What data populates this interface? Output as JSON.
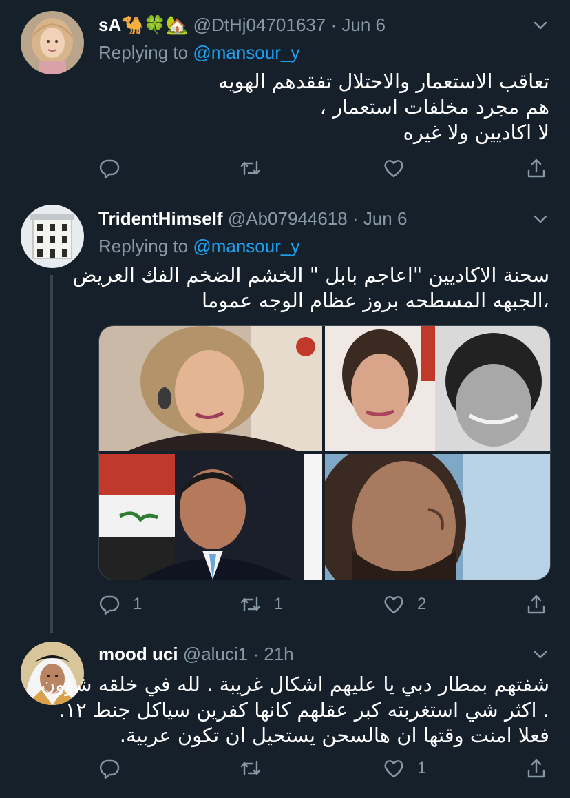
{
  "tweets": [
    {
      "name": "sA🐪🍀🏡",
      "handle": "@DtHj04701637",
      "dot": "·",
      "time": "Jun 6",
      "replying_label": "Replying to ",
      "replying_to": "@mansour_y",
      "lines": [
        "تعاقب الاستعمار والاحتلال تفقدهم الهويه",
        "هم مجرد مخلفات استعمار ،",
        "لا اكاديين ولا غيره"
      ],
      "reply_count": "",
      "retweet_count": "",
      "like_count": ""
    },
    {
      "name": "TridentHimself",
      "handle": "@Ab07944618",
      "dot": "·",
      "time": "Jun 6",
      "replying_label": "Replying to ",
      "replying_to": "@mansour_y",
      "lines": [
        "سحنة الاكاديين \"اعاجم بابل \" الخشم الضخم الفك العريض",
        "،الجبهه المسطحه بروز عظام الوجه عموما"
      ],
      "reply_count": "1",
      "retweet_count": "1",
      "like_count": "2"
    },
    {
      "name": "mood uci",
      "handle": "@aluci1",
      "dot": "·",
      "time": "21h",
      "lines": [
        "شفتهم بمطار دبي يا عليهم اشكال غريبة . لله في خلقه شؤون",
        ". اكثر شي استغربته كبر عقلهم كانها كفرين سياكل جنط ١٢.",
        "فعلا امنت وقتها ان هالسحن يستحيل ان تكون عربية."
      ],
      "reply_count": "",
      "retweet_count": "",
      "like_count": "1"
    }
  ],
  "icons": {
    "reply": "reply-icon",
    "retweet": "retweet-icon",
    "like": "heart-icon",
    "share": "share-icon",
    "menu": "chevron-down-icon"
  },
  "colors": {
    "background": "#15202b",
    "secondary_text": "#8899a6",
    "link": "#1da1f2",
    "divider": "#38444d"
  }
}
